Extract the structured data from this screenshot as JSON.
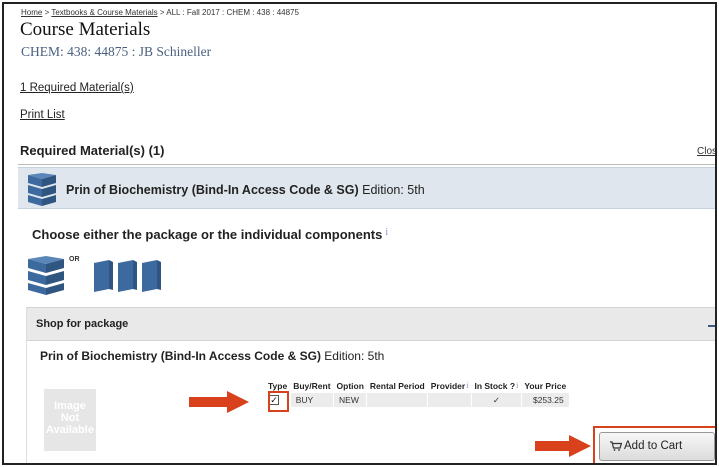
{
  "breadcrumb": {
    "home": "Home",
    "sep1": " > ",
    "textbooks": "Textbooks & Course Materials",
    "rest": " > ALL : Fall 2017 : CHEM : 438 : 44875"
  },
  "page": {
    "title": "Course Materials",
    "course": "CHEM:  438:  44875 : JB Schineller",
    "required_link": "1 Required Material(s)",
    "print_link": "Print List",
    "required_heading": "Required Material(s) (1)",
    "close_link": "Clos"
  },
  "book": {
    "title": "Prin of Biochemistry (Bind-In Access Code & SG)",
    "edition_label": "Edition: 5th"
  },
  "choose": {
    "text": "Choose either the package or the individual components",
    "info": "i",
    "or": "OR"
  },
  "shop": {
    "label": "Shop for package",
    "item_title": "Prin of Biochemistry (Bind-In Access Code & SG)",
    "item_edition": "Edition: 5th",
    "image_na": [
      "Image",
      "Not",
      "Available"
    ]
  },
  "table": {
    "headers": [
      "Type",
      "Buy/Rent",
      "Option",
      "Rental Period",
      "Provider",
      "In Stock ?",
      "Your Price"
    ],
    "row": {
      "checked": "✓",
      "buy_rent": "BUY",
      "option": "NEW",
      "rental_period": "",
      "provider": "",
      "in_stock": "✓",
      "price": "$253.25"
    }
  },
  "cart": {
    "label": "Add to Cart"
  },
  "colors": {
    "highlight": "#d9401c",
    "book_blue": "#3d6a9e",
    "link_blue": "#4a6080"
  }
}
